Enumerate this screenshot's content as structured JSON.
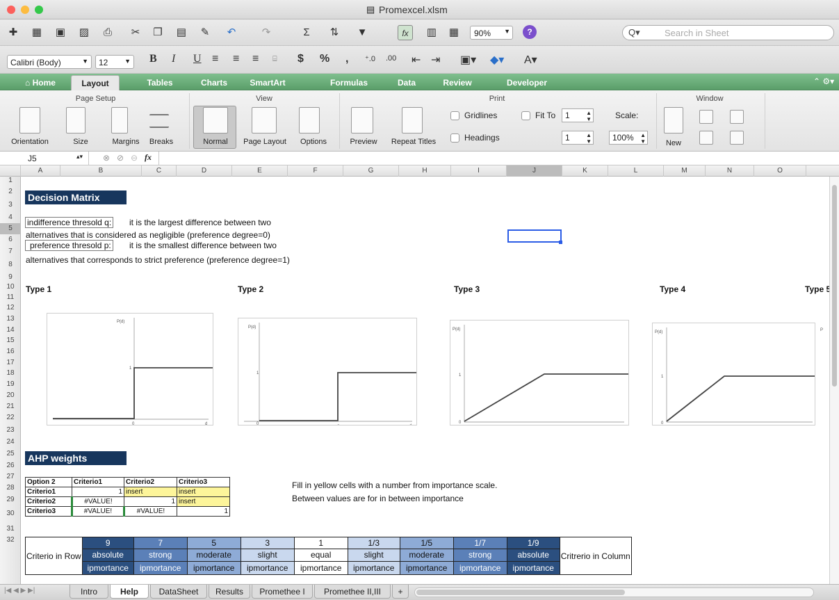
{
  "window": {
    "title": "Promexcel.xlsm"
  },
  "toolbar": {
    "zoom": "90%",
    "search_placeholder": "Search in Sheet"
  },
  "format": {
    "font": "Calibri (Body)",
    "size": "12"
  },
  "ribbon_tabs": [
    "Home",
    "Layout",
    "Tables",
    "Charts",
    "SmartArt",
    "Formulas",
    "Data",
    "Review",
    "Developer"
  ],
  "ribbon": {
    "page_setup": {
      "title": "Page Setup",
      "items": [
        "Orientation",
        "Size",
        "Margins",
        "Breaks"
      ]
    },
    "view": {
      "title": "View",
      "items": [
        "Normal",
        "Page Layout",
        "Options"
      ]
    },
    "print": {
      "title": "Print",
      "items": [
        "Preview",
        "Repeat Titles"
      ],
      "gridlines": "Gridlines",
      "headings": "Headings",
      "fit_to": "Fit To",
      "fit_w": "1",
      "fit_h": "1",
      "scale_label": "Scale:",
      "scale": "100%"
    },
    "window": {
      "title": "Window",
      "new": "New"
    }
  },
  "formula_bar": {
    "cell": "J5",
    "fx": "fx"
  },
  "columns": [
    "A",
    "B",
    "C",
    "D",
    "E",
    "F",
    "G",
    "H",
    "I",
    "J",
    "K",
    "L",
    "M",
    "N",
    "O"
  ],
  "rows": [
    "1",
    "2",
    "3",
    "4",
    "5",
    "6",
    "7",
    "8",
    "9",
    "10",
    "11",
    "12",
    "13",
    "14",
    "15",
    "16",
    "17",
    "18",
    "19",
    "20",
    "21",
    "22",
    "23",
    "24",
    "25",
    "26",
    "27",
    "28",
    "29",
    "30",
    "31",
    "32"
  ],
  "sheet": {
    "title": "Decision Matrix",
    "r4_box": "indifference thresold q:",
    "r4_text": "it is the largest difference between two",
    "r5_text": "alternatives that is considered as negligible (preference degree=0)",
    "r6_box": "preference thresold p:",
    "r6_text": "it is the smallest difference between two",
    "r7_text": "alternatives that corresponds to strict preference (preference degree=1)",
    "types": [
      "Type 1",
      "Type 2",
      "Type 3",
      "Type 4",
      "Type 5"
    ],
    "ahp_title": "AHP weights",
    "ahp_headers": [
      "Option 2",
      "Criterio1",
      "Criterio2",
      "Criterio3"
    ],
    "ahp_rows": [
      [
        "Criterio1",
        "1",
        "insert",
        "insert"
      ],
      [
        "Criterio2",
        "#VALUE!",
        "1",
        "insert"
      ],
      [
        "Criterio3",
        "#VALUE!",
        "#VALUE!",
        "1"
      ]
    ],
    "note1": "Fill in yellow cells with a number from importance scale.",
    "note2": "Between values are for in between importance",
    "scale_row_label": "Criterio in Row",
    "scale_col_label": "Critrerio in Column",
    "scale_values": [
      "9",
      "7",
      "5",
      "3",
      "1",
      "1/3",
      "1/5",
      "1/7",
      "1/9"
    ],
    "scale_words": [
      "absolute",
      "strong",
      "moderate",
      "slight",
      "equal",
      "slight",
      "moderate",
      "strong",
      "absolute"
    ],
    "scale_imp": "ipmortance"
  },
  "sheet_tabs": [
    "Intro",
    "Help",
    "DataSheet",
    "Results",
    "Promethee I",
    "Promethee II,III"
  ]
}
